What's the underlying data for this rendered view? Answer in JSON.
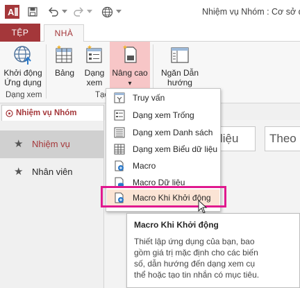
{
  "window": {
    "title": "Nhiệm vụ Nhóm : Cơ sở dữ"
  },
  "tabs": {
    "file": "TỆP",
    "home": "NHÀ"
  },
  "ribbon": {
    "application_parts": {
      "label_line1": "Khởi động",
      "label_line2": "Ứng dụng",
      "group": "Dạng xem"
    },
    "table": {
      "label": "Bảng"
    },
    "view": {
      "label_line1": "Dạng",
      "label_line2": "xem"
    },
    "advanced": {
      "label": "Nâng cao",
      "arrow": "▾"
    },
    "create_group": "Tạo",
    "navigation": {
      "label_line1": "Ngăn Dẫn",
      "label_line2": "hướng"
    }
  },
  "document_tab": {
    "label": "Nhiệm vụ Nhóm"
  },
  "nav": {
    "items": [
      {
        "label": "Nhiệm vụ",
        "icon": "star-icon"
      },
      {
        "label": "Nhân viên",
        "icon": "star-icon"
      }
    ]
  },
  "content": {
    "box1": "liệu",
    "box2": "Theo"
  },
  "menu": {
    "items": [
      {
        "label": "Truy vấn",
        "icon": "query-icon"
      },
      {
        "label": "Dạng xem Trống",
        "icon": "blank-view-icon"
      },
      {
        "label": "Dạng xem Danh sách",
        "icon": "list-view-icon"
      },
      {
        "label": "Dạng xem Biểu dữ liệu",
        "icon": "datasheet-view-icon"
      },
      {
        "label": "Macro",
        "icon": "macro-icon"
      },
      {
        "label": "Macro Dữ liệu",
        "icon": "data-macro-icon"
      },
      {
        "label": "Macro Khi Khởi động",
        "icon": "startup-macro-icon"
      }
    ]
  },
  "tooltip": {
    "title": "Macro Khi Khởi động",
    "line1": "Thiết lập ứng dụng của bạn, bao",
    "line2": "gồm giá trị mặc định cho các biến",
    "line3": "số, dẫn hướng đến dạng xem cụ",
    "line4": "thể hoặc tạo tin nhắn có mục tiêu."
  },
  "colors": {
    "accent": "#a4373a",
    "highlight": "#e0198e",
    "hover": "#fbe4d5",
    "active_button": "#f7c6c7"
  }
}
